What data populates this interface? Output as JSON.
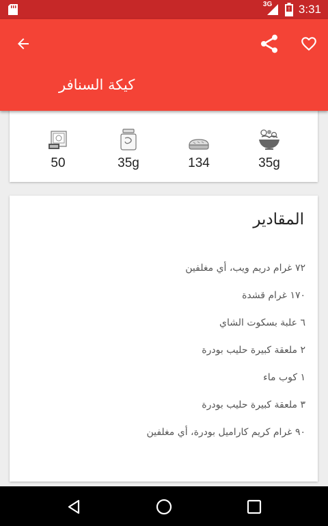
{
  "status_bar": {
    "time": "3:31",
    "network": "3G",
    "icons": [
      "sd-card-icon",
      "signal-icon",
      "battery-icon"
    ]
  },
  "app_bar": {
    "title": "كيكة السنافر",
    "back_icon": "arrow-back-icon",
    "share_icon": "share-icon",
    "favorite_icon": "heart-outline-icon",
    "color": "#f44336",
    "status_color": "#c62828"
  },
  "stats": [
    {
      "icon": "scale-icon",
      "value": "50"
    },
    {
      "icon": "jar-icon",
      "value": "35g"
    },
    {
      "icon": "bread-icon",
      "value": "134"
    },
    {
      "icon": "salad-bowl-icon",
      "value": "35g"
    }
  ],
  "ingredients": {
    "title": "المقادير",
    "items": [
      "٧٢ غرام دريم ويب، أي مغلفين",
      "١٧٠ غرام قشدة",
      "٦ علبة بسكوت الشاي",
      "٢ ملعقة كبيرة حليب بودرة",
      "١ كوب ماء",
      "٣ ملعقة كبيرة حليب بودرة",
      "٩٠ غرام كريم كاراميل بودرة، أي مغلفين"
    ]
  },
  "nav_bar": {
    "back_icon": "nav-back-icon",
    "home_icon": "nav-home-icon",
    "recents_icon": "nav-recents-icon"
  }
}
